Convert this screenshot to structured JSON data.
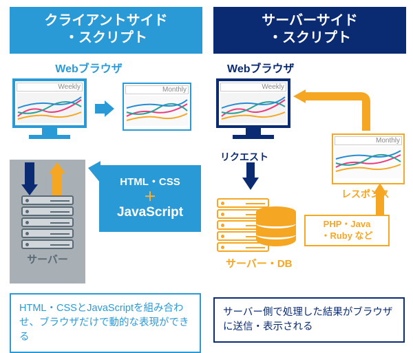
{
  "left": {
    "header_line1": "クライアントサイド",
    "header_line2": "・スクリプト",
    "browser_label": "Webブラウザ",
    "chart1_label": "Weekly",
    "chart2_label": "Monthly",
    "server_label": "サーバー",
    "bubble_line1": "HTML・CSS",
    "bubble_plus": "＋",
    "bubble_js": "JavaScript",
    "caption": "HTML・CSSとJavaScriptを組み合わせ、ブラウザだけで動的な表現ができる"
  },
  "right": {
    "header_line1": "サーバーサイド",
    "header_line2": "・スクリプト",
    "browser_label": "Webブラウザ",
    "chart1_label": "Weekly",
    "chart2_label": "Monthly",
    "request_label": "リクエスト",
    "response_label": "レスポンス",
    "server_db_label": "サーバー・DB",
    "tech_line1": "PHP・Java",
    "tech_line2": "・Ruby など",
    "caption": "サーバー側で処理した結果がブラウザに送信・表示される"
  }
}
